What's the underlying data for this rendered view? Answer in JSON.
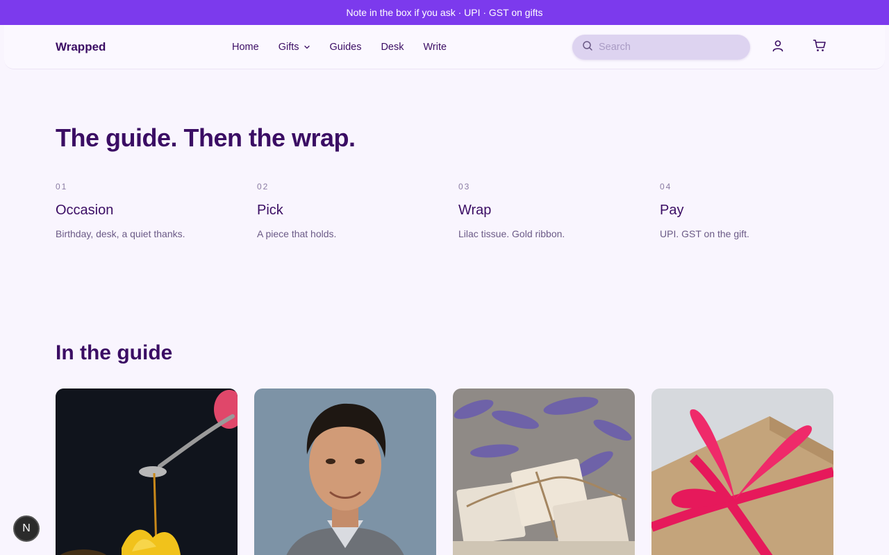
{
  "announcement": "Note in the box if you ask · UPI · GST on gifts",
  "header": {
    "logo": "Wrapped",
    "nav": [
      {
        "label": "Home"
      },
      {
        "label": "Gifts",
        "has_dropdown": true
      },
      {
        "label": "Guides"
      },
      {
        "label": "Desk"
      },
      {
        "label": "Write"
      }
    ],
    "search_placeholder": "Search",
    "icons": [
      "search-icon",
      "user-icon",
      "cart-icon",
      "chevron-down-icon"
    ]
  },
  "hero": {
    "title": "The guide. Then the wrap.",
    "steps": [
      {
        "num": "01",
        "title": "Occasion",
        "desc": "Birthday, desk, a quiet thanks."
      },
      {
        "num": "02",
        "title": "Pick",
        "desc": "A piece that holds."
      },
      {
        "num": "03",
        "title": "Wrap",
        "desc": "Lilac tissue. Gold ribbon."
      },
      {
        "num": "04",
        "title": "Pay",
        "desc": "UPI. GST on the gift."
      }
    ]
  },
  "guide": {
    "title": "In the guide",
    "cards": [
      {
        "image": "honey-spoon-photo"
      },
      {
        "image": "portrait-photo"
      },
      {
        "image": "lavender-soap-photo"
      },
      {
        "image": "ribbon-gift-photo"
      }
    ]
  },
  "badge": "N",
  "colors": {
    "accent": "#7c3aed",
    "text": "#3b0d64",
    "background": "#f9f5fe",
    "search_bg": "#ddd3f0"
  }
}
